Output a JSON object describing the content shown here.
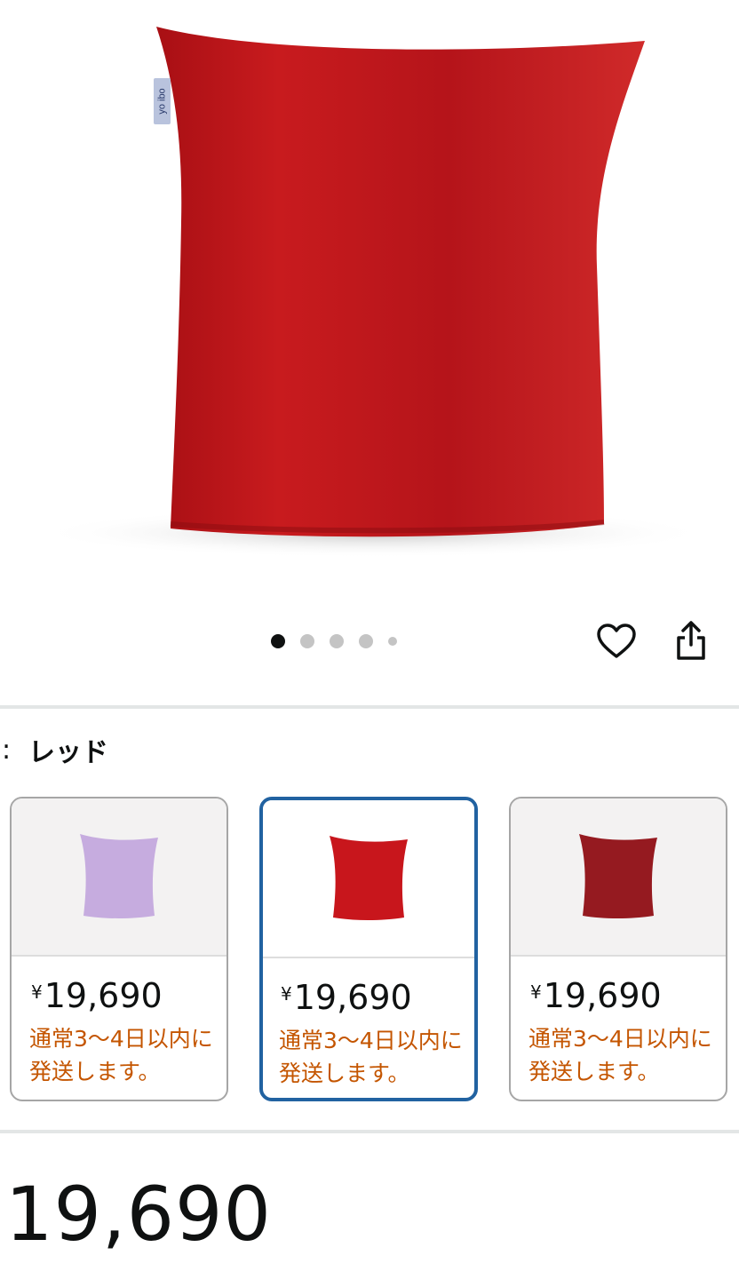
{
  "product": {
    "brand_tag": "yo ibo",
    "main_color": "#b01418"
  },
  "carousel": {
    "dots_count": 5,
    "active_index": 0
  },
  "actions": {
    "wishlist_icon": "heart-outline-icon",
    "share_icon": "share-icon"
  },
  "color_selection": {
    "label": ":",
    "selected_name": "レッド"
  },
  "variants": [
    {
      "color": "#c6acdf",
      "price_symbol": "¥",
      "price": "19,690",
      "shipping": "通常3〜4日以内に発送します。",
      "selected": false
    },
    {
      "color": "#c8161c",
      "price_symbol": "¥",
      "price": "19,690",
      "shipping": "通常3〜4日以内に発送します。",
      "selected": true
    },
    {
      "color": "#951a20",
      "price_symbol": "¥",
      "price": "19,690",
      "shipping": "通常3〜4日以内に発送します。",
      "selected": false
    }
  ],
  "price_display": "19,690"
}
